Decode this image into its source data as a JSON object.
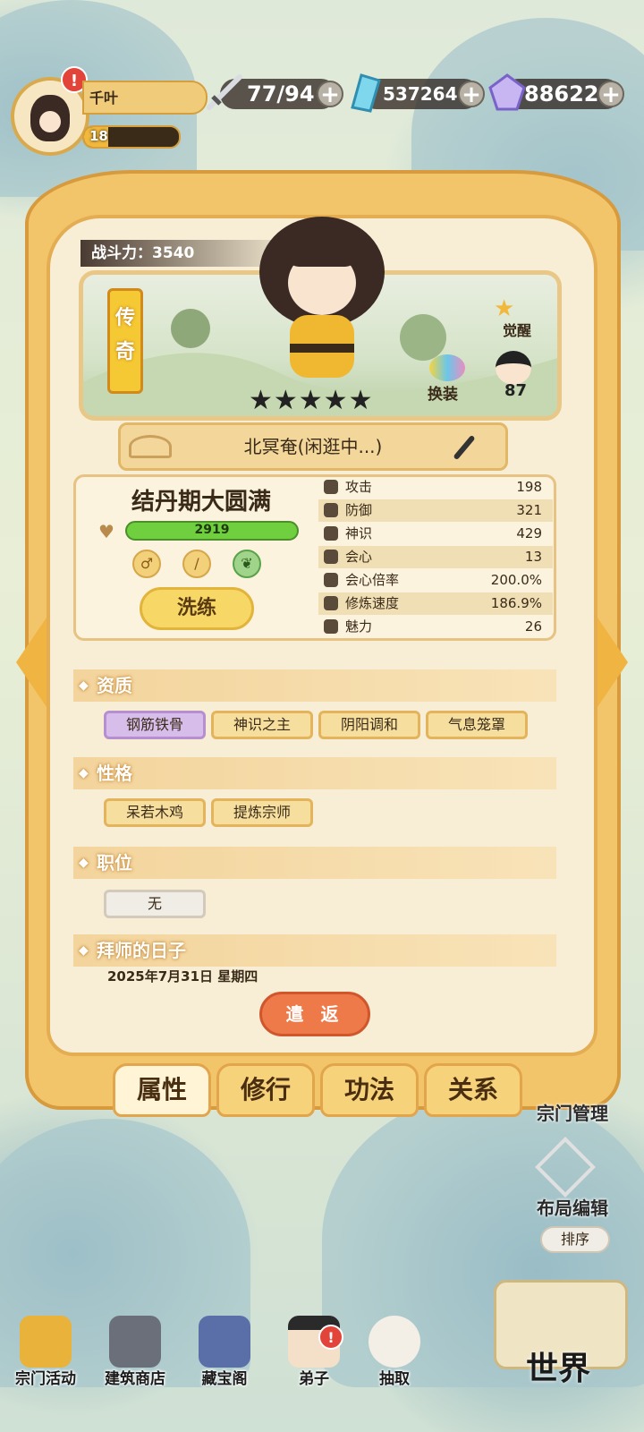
{
  "player": {
    "name": "千叶",
    "level": "18",
    "level_progress": 0.25,
    "alert": "!"
  },
  "resources": {
    "stamina": "77/94",
    "crystals": "537264",
    "gems": "88622",
    "plus": "+"
  },
  "character": {
    "combat_power_label": "战斗力：3540",
    "rarity_line1": "传",
    "rarity_line2": "奇",
    "stars": "★★★★★",
    "awaken": "觉醒",
    "swap": "换装",
    "count": "87",
    "location": "北冥奄(闲逛中...)",
    "realm": "结丹期大圆满",
    "hp": "2919",
    "refine_button": "洗练"
  },
  "stats": [
    {
      "name": "攻击",
      "value": "198"
    },
    {
      "name": "防御",
      "value": "321"
    },
    {
      "name": "神识",
      "value": "429"
    },
    {
      "name": "会心",
      "value": "13"
    },
    {
      "name": "会心倍率",
      "value": "200.0%"
    },
    {
      "name": "修炼速度",
      "value": "186.9%"
    },
    {
      "name": "魅力",
      "value": "26"
    }
  ],
  "sections": {
    "aptitude": "资质",
    "personality": "性格",
    "position": "职位",
    "mentor_date": "拜师的日子"
  },
  "aptitude_tags": [
    "钢筋铁骨",
    "神识之主",
    "阴阳调和",
    "气息笼罩"
  ],
  "personality_tags": [
    "呆若木鸡",
    "提炼宗师"
  ],
  "position_tag": "无",
  "date": "2025年7月31日 星期四",
  "return_button": "遣 返",
  "tabs": [
    "属性",
    "修行",
    "功法",
    "关系"
  ],
  "side": {
    "sect_manage": "宗门管理",
    "layout_edit": "布局编辑",
    "sort": "排序"
  },
  "bottom_nav": [
    "宗门活动",
    "建筑商店",
    "藏宝阁",
    "弟子",
    "抽取"
  ],
  "world": "世界",
  "colors": {
    "panel": "#f3c56a",
    "accent_orange": "#ee7a4a",
    "hp_green": "#6fcf3f",
    "purple_tag": "#d7bdea"
  }
}
